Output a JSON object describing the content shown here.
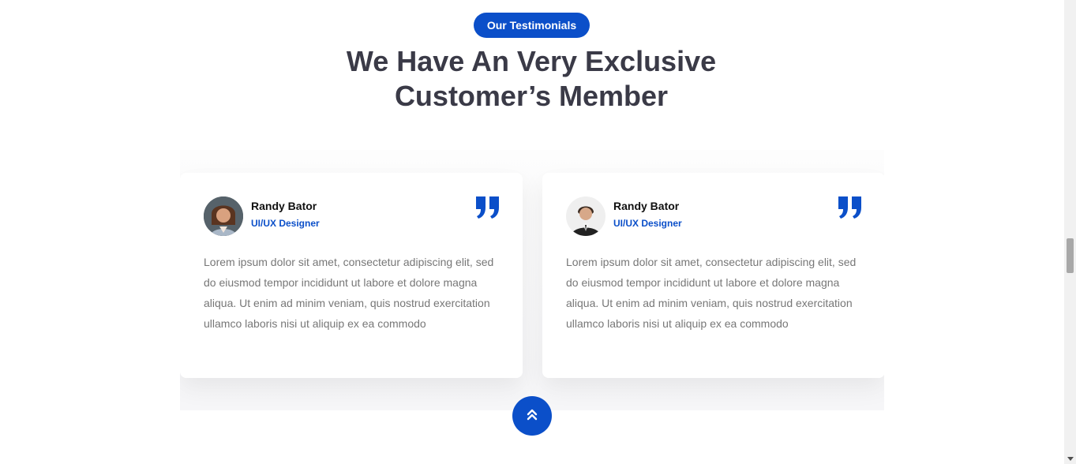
{
  "section": {
    "badge": "Our Testimonials",
    "heading_line1": "We Have An Very Exclusive",
    "heading_line2": "Customer’s Member"
  },
  "testimonials": [
    {
      "name": "Randy Bator",
      "role": "UI/UX Designer",
      "text": "Lorem ipsum dolor sit amet, consectetur adipiscing elit, sed do eiusmod tempor incididunt ut labore et dolore magna aliqua. Ut enim ad minim veniam, quis nostrud exercitation ullamco laboris nisi ut aliquip ex ea commodo",
      "icon": "quote-icon"
    },
    {
      "name": "Randy Bator",
      "role": "UI/UX Designer",
      "text": "Lorem ipsum dolor sit amet, consectetur adipiscing elit, sed do eiusmod tempor incididunt ut labore et dolore magna aliqua. Ut enim ad minim veniam, quis nostrud exercitation ullamco laboris nisi ut aliquip ex ea commodo",
      "icon": "quote-icon"
    }
  ],
  "scroll_top": {
    "icon": "double-chevron-up-icon"
  },
  "colors": {
    "accent": "#0b4fc9",
    "heading": "#3a3a47",
    "body_text": "#777777"
  }
}
